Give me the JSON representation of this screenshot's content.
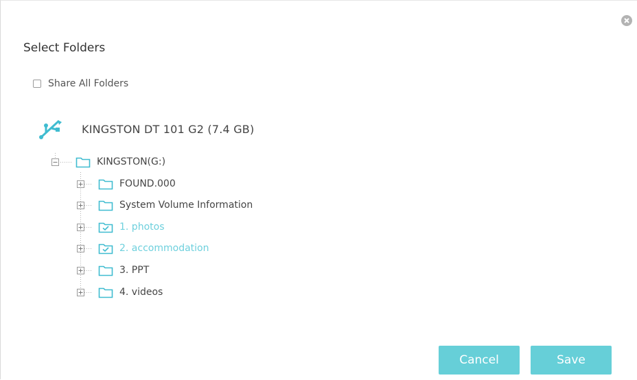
{
  "dialog": {
    "title": "Select Folders",
    "close_icon": "close-icon",
    "share_all": {
      "label": "Share All Folders",
      "checked": false
    }
  },
  "device": {
    "icon": "usb-icon",
    "name": "KINGSTON DT 101 G2 (7.4 GB)"
  },
  "tree": {
    "root": {
      "label": "KINGSTON(G:)",
      "expanded": true,
      "icon": "folder-icon"
    },
    "children": [
      {
        "label": "FOUND.000",
        "checked": false,
        "icon": "folder-icon"
      },
      {
        "label": "System Volume Information",
        "checked": false,
        "icon": "folder-icon"
      },
      {
        "label": "1. photos",
        "checked": true,
        "icon": "folder-checked-icon"
      },
      {
        "label": "2. accommodation",
        "checked": true,
        "icon": "folder-checked-icon"
      },
      {
        "label": "3. PPT",
        "checked": false,
        "icon": "folder-icon"
      },
      {
        "label": "4. videos",
        "checked": false,
        "icon": "folder-icon"
      }
    ]
  },
  "buttons": {
    "cancel": "Cancel",
    "save": "Save"
  },
  "colors": {
    "accent": "#66cfd8",
    "checked_text": "#6ed0dd",
    "tree_line": "#b0b0b0"
  }
}
